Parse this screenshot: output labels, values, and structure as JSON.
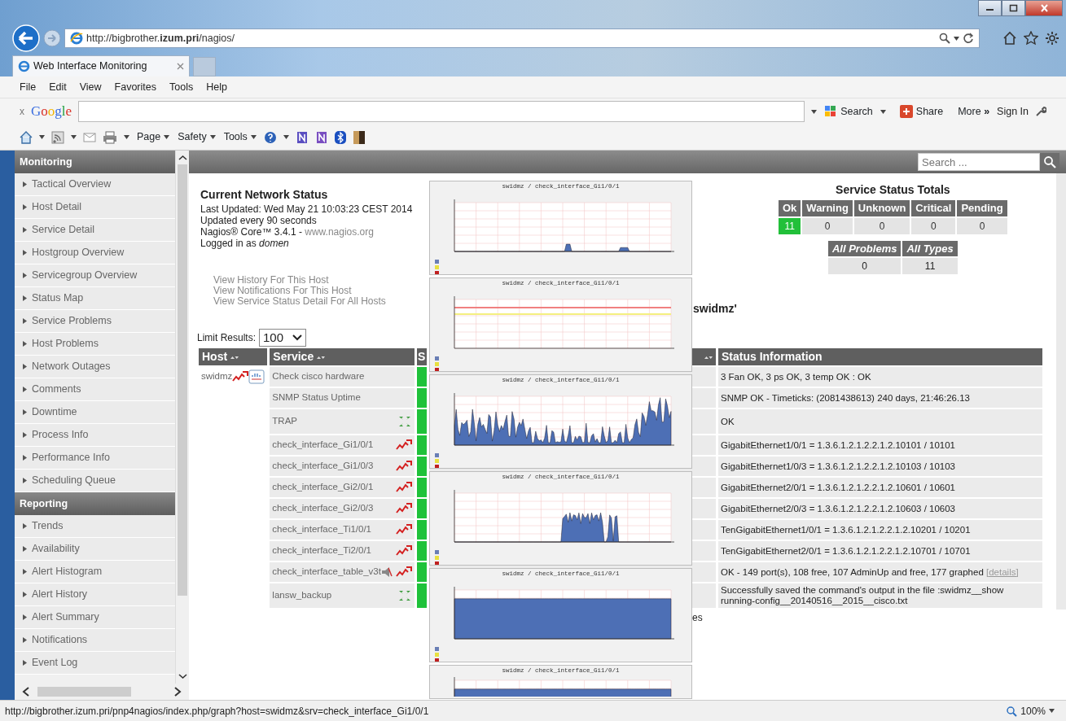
{
  "browser": {
    "address_host": "http://bigbrother.",
    "address_domain": "izum.pri",
    "address_path": "/nagios/",
    "tabs": [
      {
        "label": "Web Interface Monitoring",
        "selected": true
      }
    ],
    "menu": [
      "File",
      "Edit",
      "View",
      "Favorites",
      "Tools",
      "Help"
    ],
    "google_toolbar": {
      "close": "x",
      "logo": "Google",
      "search": "Search",
      "share": "Share",
      "more": "More",
      "more_glyph": "»",
      "sign_in": "Sign In"
    },
    "command_bar": [
      "Page",
      "Safety",
      "Tools"
    ]
  },
  "sidebar": {
    "sections": [
      {
        "title": "Monitoring",
        "items": [
          "Tactical Overview",
          "Host Detail",
          "Service Detail",
          "Hostgroup Overview",
          "Servicegroup Overview",
          "Status Map",
          "Service Problems",
          "Host Problems",
          "Network Outages",
          "Comments",
          "Downtime",
          "Process Info",
          "Performance Info",
          "Scheduling Queue"
        ]
      },
      {
        "title": "Reporting",
        "items": [
          "Trends",
          "Availability",
          "Alert Histogram",
          "Alert History",
          "Alert Summary",
          "Notifications",
          "Event Log"
        ]
      }
    ]
  },
  "top_bar": {
    "search_placeholder": "Search ..."
  },
  "info": {
    "title": "Current Network Status",
    "lines": [
      "Last Updated: Wed May 21 10:03:23 CEST 2014",
      "Updated every 90 seconds"
    ],
    "version": "Nagios® Core™ 3.4.1 - ",
    "version_link": "www.nagios.org",
    "logged_in": "Logged in as *domen*"
  },
  "links": [
    "View History For This Host",
    "View Notifications For This Host",
    "View Service Status Detail For All Hosts"
  ],
  "totals": {
    "title": "Service Status Totals",
    "states": [
      {
        "label": "Ok",
        "value": "11",
        "color": "#22c03a"
      },
      {
        "label": "Warning",
        "value": "0",
        "color": "#e4e4e4"
      },
      {
        "label": "Unknown",
        "value": "0",
        "color": "#e4e4e4"
      },
      {
        "label": "Critical",
        "value": "0",
        "color": "#e4e4e4"
      },
      {
        "label": "Pending",
        "value": "0",
        "color": "#e4e4e4"
      }
    ],
    "summary": [
      {
        "label": "All Problems",
        "value": "0"
      },
      {
        "label": "All Types",
        "value": "11"
      }
    ]
  },
  "heading_fragment": "swidmz'",
  "limit": {
    "label": "Limit Results:",
    "value": "100"
  },
  "table": {
    "columns": [
      {
        "label": "Host",
        "sortable": true
      },
      {
        "label": "Service",
        "sortable": true
      },
      {
        "label": "S",
        "sortable": false
      },
      {
        "sortable": true
      },
      {
        "label": "Status Information",
        "sortable": false
      }
    ],
    "rows": [
      {
        "host": "swidmz",
        "service": "Check cisco hardware",
        "kind": "plain",
        "color": "#1fc23a",
        "info": "3 Fan OK, 3 ps OK, 3 temp OK : OK"
      },
      {
        "service": "SNMP Status Uptime",
        "kind": "plain",
        "color": "#1fc23a",
        "info": "SNMP OK - Timeticks: (2081438613) 240 days, 21:46:26.13"
      },
      {
        "service": "TRAP",
        "kind": "passive",
        "color": "#1fc23a",
        "info": "OK"
      },
      {
        "service": "check_interface_Gi1/0/1",
        "kind": "graphed",
        "color": "#1fc23a",
        "info": "GigabitEthernet1/0/1 = 1.3.6.1.2.1.2.2.1.2.10101 / 10101"
      },
      {
        "service": "check_interface_Gi1/0/3",
        "kind": "graphed",
        "color": "#1fc23a",
        "info": "GigabitEthernet1/0/3 = 1.3.6.1.2.1.2.2.1.2.10103 / 10103"
      },
      {
        "service": "check_interface_Gi2/0/1",
        "kind": "graphed",
        "color": "#1fc23a",
        "info": "GigabitEthernet2/0/1 = 1.3.6.1.2.1.2.2.1.2.10601 / 10601"
      },
      {
        "service": "check_interface_Gi2/0/3",
        "kind": "graphed",
        "color": "#1fc23a",
        "info": "GigabitEthernet2/0/3 = 1.3.6.1.2.1.2.2.1.2.10603 / 10603"
      },
      {
        "service": "check_interface_Ti1/0/1",
        "kind": "graphed",
        "color": "#1fc23a",
        "info": "TenGigabitEthernet1/0/1 = 1.3.6.1.2.1.2.2.1.2.10201 / 10201"
      },
      {
        "service": "check_interface_Ti2/0/1",
        "kind": "graphed",
        "color": "#1fc23a",
        "info": "TenGigabitEthernet2/0/1 = 1.3.6.1.2.1.2.2.1.2.10701 / 10701"
      },
      {
        "service": "check_interface_table_v3t",
        "kind": "muted",
        "color": "#1fc23a",
        "info": "OK - 149 port(s), 108 free, 107 AdminUp and free, 177 graphed",
        "details": "[details]"
      },
      {
        "service": "lansw_backup",
        "kind": "passive",
        "color": "#1fc23a",
        "info": "Successfully saved the command's output in the file :swidmz__show running-config__20140516__2015__cisco.txt"
      }
    ]
  },
  "footer_fragment": "es",
  "graphs": [
    {
      "title": "swidmz / check_interface_Gi1/0/1",
      "kind": "bumps"
    },
    {
      "title": "swidmz / check_interface_Gi1/0/1",
      "kind": "thresholds"
    },
    {
      "title": "swidmz / check_interface_Gi1/0/1",
      "kind": "dense"
    },
    {
      "title": "swidmz / check_interface_Gi1/0/1",
      "kind": "late"
    },
    {
      "title": "swidmz / check_interface_Gi1/0/1",
      "kind": "full"
    },
    {
      "title": "swidmz / check_interface_Gi1/0/1",
      "kind": "full_cut"
    }
  ],
  "status_bar": {
    "url": "http://bigbrother.izum.pri/pnp4nagios/index.php/graph?host=swidmz&srv=check_interface_Gi1/0/1",
    "zoom": "100%"
  }
}
